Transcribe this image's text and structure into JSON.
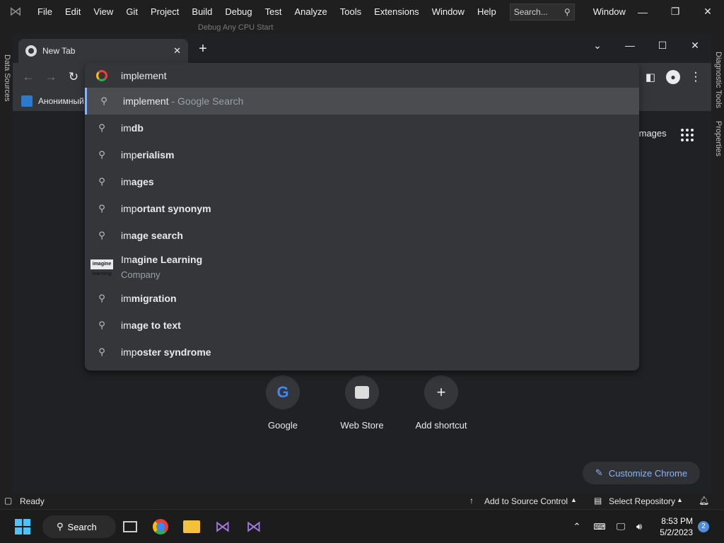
{
  "vs": {
    "menu": [
      "File",
      "Edit",
      "View",
      "Git",
      "Project",
      "Build",
      "Debug",
      "Test",
      "Analyze",
      "Tools",
      "Extensions",
      "Window",
      "Help"
    ],
    "search_label": "Search...",
    "window_title": "Window",
    "toolbar_text": "Debug   Any CPU   Start",
    "left_strip": "Data Sources",
    "right_strip_1": "Diagnostic Tools",
    "right_strip_2": "Properties",
    "status_ready": "Ready",
    "status_source_control": "Add to Source Control",
    "status_repository": "Select Repository"
  },
  "chrome": {
    "tab_title": "New Tab",
    "bookmark_label": "Анонимный",
    "omnibox_value": "implement",
    "suggestions": [
      {
        "prefix": "implement",
        "bold": "",
        "suffix": " - Google Search"
      },
      {
        "prefix": "im",
        "bold": "db",
        "suffix": ""
      },
      {
        "prefix": "imp",
        "bold": "erialism",
        "suffix": ""
      },
      {
        "prefix": "im",
        "bold": "ages",
        "suffix": ""
      },
      {
        "prefix": "imp",
        "bold": "ortant synonym",
        "suffix": ""
      },
      {
        "prefix": "im",
        "bold": "age search",
        "suffix": ""
      },
      {
        "prefix": "im",
        "bold": "migration",
        "suffix": ""
      },
      {
        "prefix": "im",
        "bold": "age to text",
        "suffix": ""
      },
      {
        "prefix": "imp",
        "bold": "oster syndrome",
        "suffix": ""
      }
    ],
    "entity": {
      "prefix": "Im",
      "bold": "agine Learning",
      "subtitle": "Company",
      "logo_text": "imagine learning"
    },
    "images_link": "Images",
    "shortcuts": [
      "Google",
      "Web Store",
      "Add shortcut"
    ],
    "customize_label": "Customize Chrome"
  },
  "taskbar": {
    "search_label": "Search",
    "time": "8:53 PM",
    "date": "5/2/2023",
    "notification_count": "2"
  },
  "colors": {
    "accent": "#8ab4f8",
    "selected_row": "#4a4c50",
    "ntp_bg": "#202124"
  }
}
